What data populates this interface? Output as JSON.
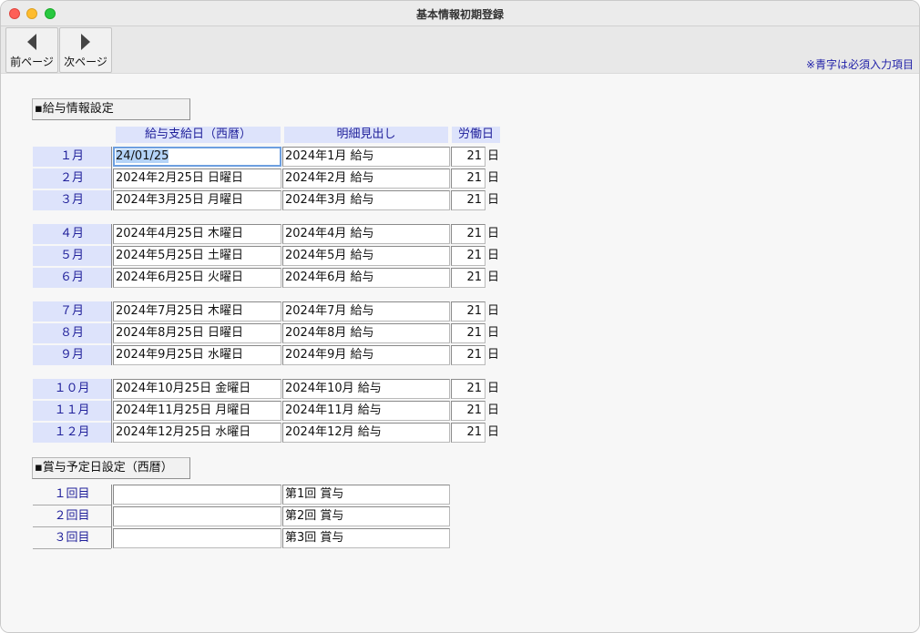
{
  "window": {
    "title": "基本情報初期登録"
  },
  "toolbar": {
    "prev_label": "前ページ",
    "next_label": "次ページ",
    "required_note": "※青字は必須入力項目"
  },
  "salary_section": {
    "header": "▪給与情報設定",
    "columns": {
      "pay_date": "給与支給日（西暦）",
      "heading": "明細見出し",
      "work_days": "労働日"
    },
    "day_unit": "日",
    "rows": [
      {
        "month": "１月",
        "pay_date": "24/01/25",
        "heading": "2024年1月 給与",
        "days": "21"
      },
      {
        "month": "２月",
        "pay_date": "2024年2月25日 日曜日",
        "heading": "2024年2月 給与",
        "days": "21"
      },
      {
        "month": "３月",
        "pay_date": "2024年3月25日 月曜日",
        "heading": "2024年3月 給与",
        "days": "21"
      },
      {
        "month": "４月",
        "pay_date": "2024年4月25日 木曜日",
        "heading": "2024年4月 給与",
        "days": "21"
      },
      {
        "month": "５月",
        "pay_date": "2024年5月25日 土曜日",
        "heading": "2024年5月 給与",
        "days": "21"
      },
      {
        "month": "６月",
        "pay_date": "2024年6月25日 火曜日",
        "heading": "2024年6月 給与",
        "days": "21"
      },
      {
        "month": "７月",
        "pay_date": "2024年7月25日 木曜日",
        "heading": "2024年7月 給与",
        "days": "21"
      },
      {
        "month": "８月",
        "pay_date": "2024年8月25日 日曜日",
        "heading": "2024年8月 給与",
        "days": "21"
      },
      {
        "month": "９月",
        "pay_date": "2024年9月25日 水曜日",
        "heading": "2024年9月 給与",
        "days": "21"
      },
      {
        "month": "１０月",
        "pay_date": "2024年10月25日 金曜日",
        "heading": "2024年10月 給与",
        "days": "21"
      },
      {
        "month": "１１月",
        "pay_date": "2024年11月25日 月曜日",
        "heading": "2024年11月 給与",
        "days": "21"
      },
      {
        "month": "１２月",
        "pay_date": "2024年12月25日 水曜日",
        "heading": "2024年12月 給与",
        "days": "21"
      }
    ]
  },
  "bonus_section": {
    "header": "▪賞与予定日設定（西暦）",
    "rows": [
      {
        "label": "１回目",
        "date": "",
        "heading": "第1回 賞与"
      },
      {
        "label": "２回目",
        "date": "",
        "heading": "第2回 賞与"
      },
      {
        "label": "３回目",
        "date": "",
        "heading": "第3回 賞与"
      }
    ]
  }
}
